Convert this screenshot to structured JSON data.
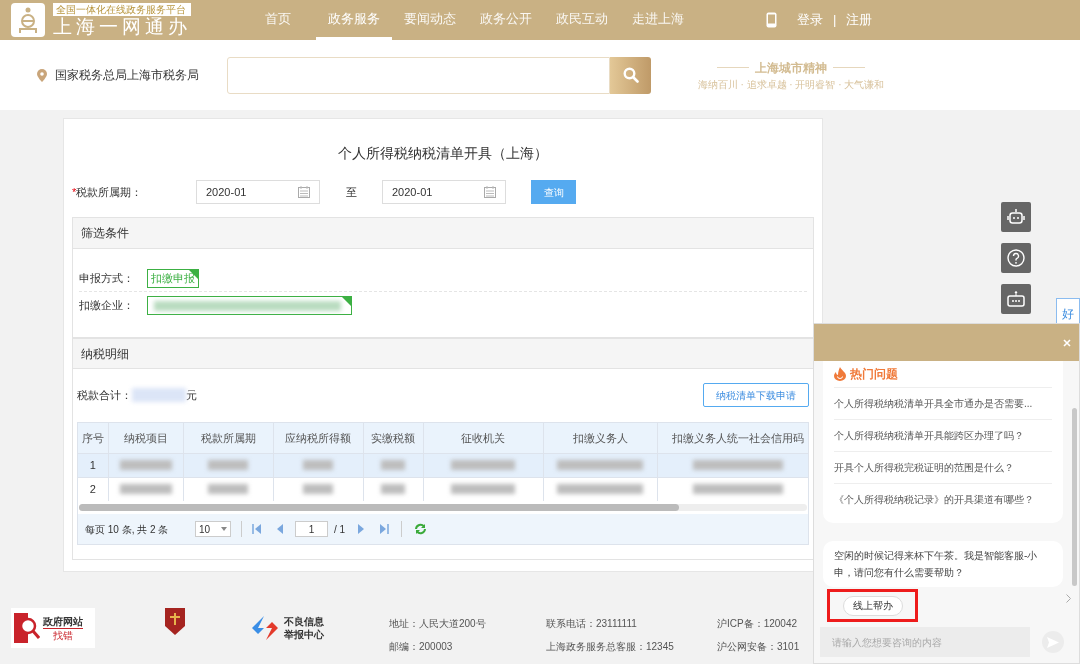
{
  "header": {
    "platform_tag": "全国一体化在线政务服务平台",
    "site_name": "上海一网通办",
    "nav": [
      {
        "label": "首页",
        "selected": false
      },
      {
        "label": "政务服务",
        "selected": true
      },
      {
        "label": "要闻动态",
        "selected": false
      },
      {
        "label": "政务公开",
        "selected": false
      },
      {
        "label": "政民互动",
        "selected": false
      },
      {
        "label": "走进上海",
        "selected": false
      }
    ],
    "login": "登录",
    "separator": "|",
    "register": "注册"
  },
  "subheader": {
    "location": "国家税务总局上海市税务局",
    "slogan_title": "上海城市精神",
    "slogan_subtitle": "海纳百川 · 追求卓越 · 开明睿智 · 大气谦和"
  },
  "form": {
    "title": "个人所得税纳税清单开具（上海）",
    "required": true,
    "required_mark": "*",
    "period_label": "税款所属期：",
    "start": "2020-01",
    "to": "至",
    "end": "2020-01",
    "query_button": "查询"
  },
  "filter": {
    "title": "筛选条件",
    "rows": [
      {
        "label": "申报方式：",
        "kind": "tag",
        "text": "扣缴申报",
        "selected": true
      },
      {
        "label": "扣缴企业：",
        "kind": "redacted",
        "selected": true
      }
    ]
  },
  "details": {
    "title": "纳税明细",
    "total_label": "税款合计：",
    "total_unit": "元",
    "download_button": "纳税清单下载申请",
    "table": {
      "columns": [
        "序号",
        "纳税项目",
        "税款所属期",
        "应纳税所得额",
        "实缴税额",
        "征收机关",
        "扣缴义务人",
        "扣缴义务人统一社会信用码"
      ],
      "rows": [
        {
          "cells": [
            "1"
          ],
          "selected": true
        },
        {
          "cells": [
            "2"
          ],
          "selected": false
        }
      ]
    },
    "pager": {
      "summary": "每页 10 条, 共 2 条",
      "page_size": "10",
      "page": "1",
      "page_total": "/ 1"
    }
  },
  "side_tab": "好",
  "chat": {
    "hot_title": "热门问题",
    "questions": [
      "个人所得税纳税清单开具全市通办是否需要...",
      "个人所得税纳税清单开具能跨区办理了吗？",
      "开具个人所得税完税证明的范围是什么？",
      "《个人所得税纳税记录》的开具渠道有哪些？"
    ],
    "message": "空闲的时候记得来杯下午茶。我是智能客服-小申，请问您有什么需要帮助？",
    "quick_reply": "线上帮办",
    "input_placeholder": "请输入您想要咨询的内容"
  },
  "footer": {
    "error_logo": [
      "政府网站",
      "找错"
    ],
    "report_logo": [
      "不良信息",
      "举报中心"
    ],
    "items": [
      "地址：人民大道200号",
      "联系电话：23111111",
      "沪ICP备：120042",
      "邮编：200003",
      "上海政务服务总客服：12345",
      "沪公网安备：3101"
    ]
  }
}
